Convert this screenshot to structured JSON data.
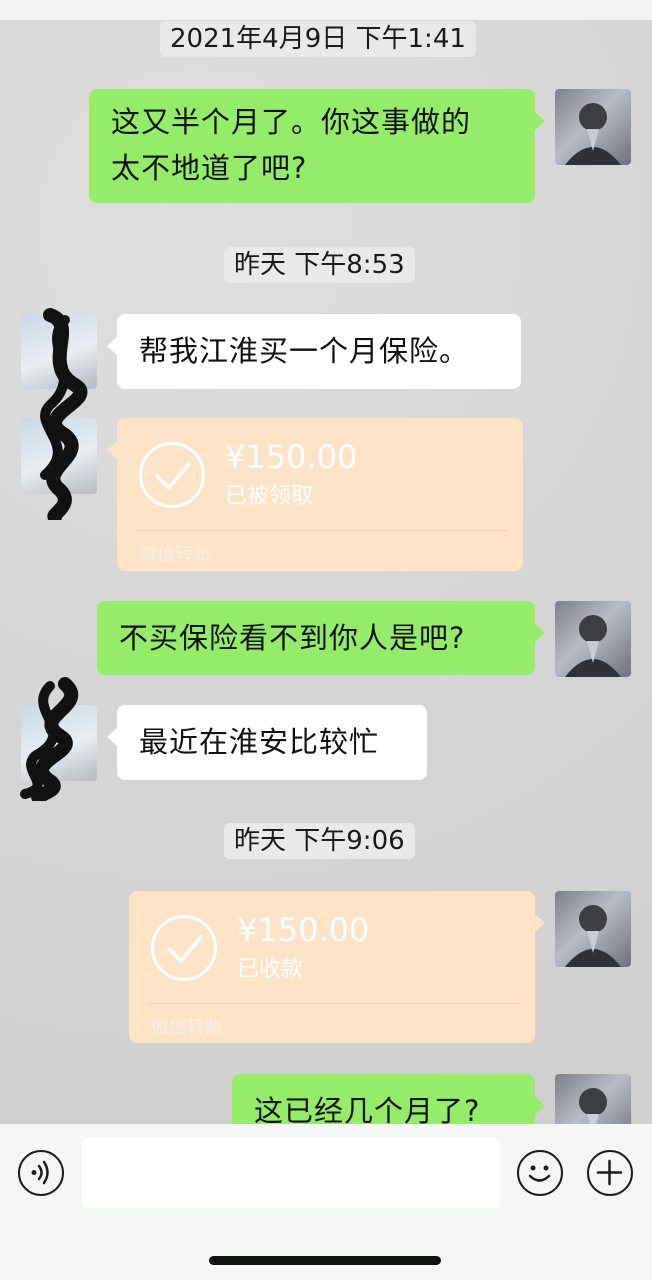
{
  "timestamps": {
    "t1": "2021年4月9日 下午1:41",
    "t2": "昨天 下午8:53",
    "t3": "昨天 下午9:06"
  },
  "messages": {
    "m1": "这又半个月了。你这事做的\n太不地道了吧?",
    "m2": "帮我江淮买一个月保险。",
    "m3": "不买保险看不到你人是吧?",
    "m4": "最近在淮安比较忙",
    "m5": "这已经几个月了?"
  },
  "transfers": {
    "received_by_them": {
      "amount": "¥150.00",
      "status": "已被领取",
      "footer": "微信转账"
    },
    "received_by_me": {
      "amount": "¥150.00",
      "status": "已收款",
      "footer": "微信转账"
    }
  },
  "input_bar": {
    "value": ""
  },
  "icons": {
    "voice": "voice-icon",
    "emoji": "emoji-icon",
    "plus": "plus-icon",
    "check": "check-icon"
  },
  "colors": {
    "my_bubble": "#95ec69",
    "their_bubble": "#ffffff",
    "transfer_card": "#fde4c7",
    "chat_background": "#d9d9d9"
  }
}
